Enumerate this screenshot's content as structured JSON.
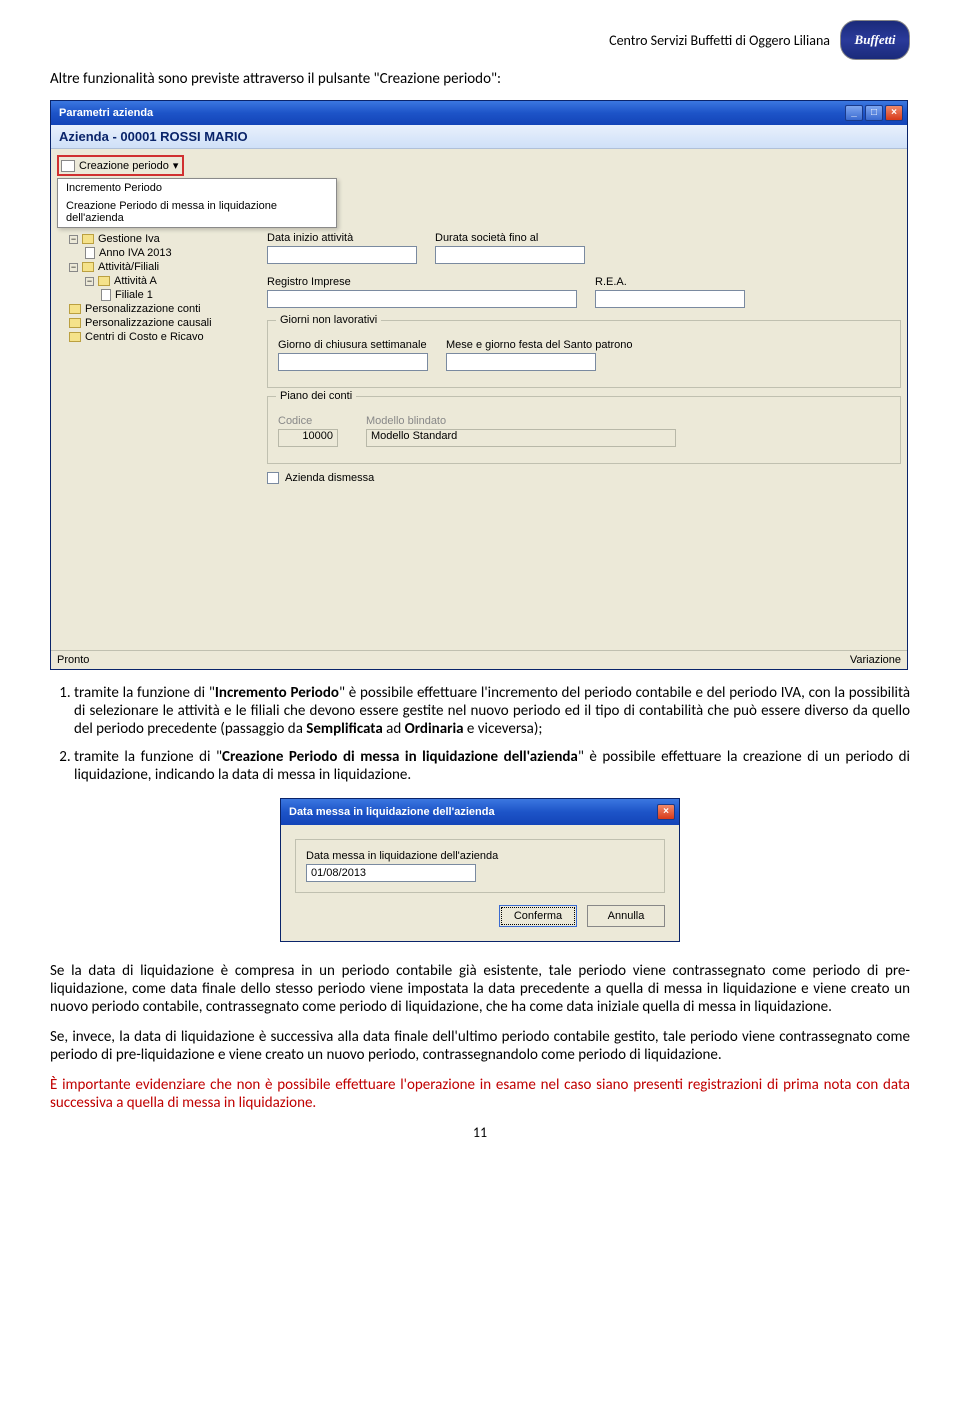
{
  "header": {
    "org": "Centro Servizi Buffetti di Oggero Liliana",
    "logo": "Buffetti"
  },
  "intro": "Altre funzionalità sono previste attraverso il pulsante \"Creazione periodo\":",
  "win": {
    "title": "Parametri azienda",
    "subtitle": "Azienda - 00001 ROSSI MARIO",
    "toolbar_btn": "Creazione periodo",
    "menu": {
      "m1": "Incremento Periodo",
      "m2": "Creazione Periodo di messa in liquidazione dell'azienda"
    },
    "tree": {
      "root": "Gestione Iva",
      "n_anno": "Anno IVA 2013",
      "n_att": "Attività/Filiali",
      "n_attA": "Attività A",
      "n_fil1": "Filiale 1",
      "n_pconti": "Personalizzazione conti",
      "n_pcaus": "Personalizzazione causali",
      "n_centri": "Centri di Costo e Ricavo"
    },
    "form": {
      "g_inizio": "Data inizio attività",
      "g_durata": "Durata società fino al",
      "g_registro": "Registro Imprese",
      "g_rea": "R.E.A.",
      "g_giorni_title": "Giorni non lavorativi",
      "g_chiusura": "Giorno di chiusura settimanale",
      "g_santo": "Mese e giorno festa del Santo patrono",
      "g_pdc_title": "Piano dei conti",
      "g_codice": "Codice",
      "g_modello": "Modello blindato",
      "pdc_codice": "10000",
      "pdc_modello": "Modello Standard",
      "chk_dismessa": "Azienda dismessa"
    },
    "status_left": "Pronto",
    "status_right": "Variazione"
  },
  "list": {
    "item1_a": "tramite la funzione di \"",
    "item1_b": "Incremento Periodo",
    "item1_c": "\" è possibile effettuare l'incremento del periodo contabile e del periodo IVA, con la possibilità di selezionare le attività e le filiali che devono essere gestite nel nuovo periodo ed il tipo di contabilità che può essere diverso da quello del periodo precedente (passaggio da ",
    "item1_d": "Semplificata",
    "item1_e": " ad ",
    "item1_f": "Ordinaria",
    "item1_g": " e viceversa);",
    "item2_a": "tramite la funzione di \"",
    "item2_b": "Creazione Periodo di messa in liquidazione dell'azienda",
    "item2_c": "\" è possibile effettuare la creazione di un periodo di liquidazione, indicando la data di messa in liquidazione."
  },
  "dlg": {
    "title": "Data messa in liquidazione dell'azienda",
    "label": "Data messa in liquidazione dell'azienda",
    "value": "01/08/2013",
    "confirm": "Conferma",
    "cancel": "Annulla"
  },
  "para1": "Se la data di liquidazione è compresa in un periodo contabile già esistente, tale periodo viene contrassegnato come periodo di pre-liquidazione, come data finale dello stesso periodo viene impostata la data precedente a quella di messa in liquidazione e viene creato un nuovo periodo contabile, contrassegnato come periodo di liquidazione, che ha come data iniziale quella di messa in liquidazione.",
  "para2": "Se, invece, la data di liquidazione è successiva alla data finale dell'ultimo periodo contabile gestito, tale periodo viene contrassegnato come periodo di pre-liquidazione e viene creato un nuovo periodo, contrassegnandolo come periodo di liquidazione.",
  "para3": "È importante evidenziare che non è possibile effettuare l'operazione in esame nel caso siano presenti registrazioni di prima nota con data successiva a quella di messa in liquidazione.",
  "page_num": "11"
}
